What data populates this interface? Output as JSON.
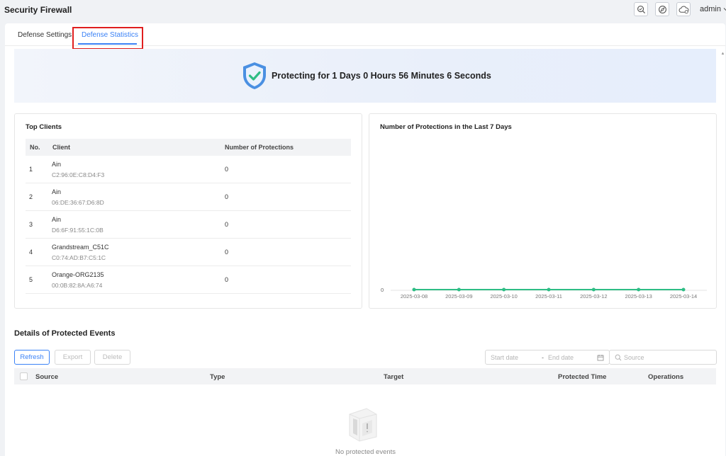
{
  "app": {
    "title": "Security Firewall",
    "user": "admin"
  },
  "topbar": {
    "icons": [
      "search-settings-icon",
      "compass-icon",
      "cloud-icon"
    ]
  },
  "tabs": [
    {
      "label": "Defense Settings",
      "active": false
    },
    {
      "label": "Defense Statistics",
      "active": true
    }
  ],
  "banner": {
    "text": "Protecting for 1 Days 0 Hours 56 Minutes 6 Seconds"
  },
  "top_clients": {
    "title": "Top Clients",
    "columns": [
      "No.",
      "Client",
      "Number of Protections"
    ],
    "rows": [
      {
        "no": "1",
        "name": "Ain",
        "mac": "C2:96:0E:C8:D4:F3",
        "count": "0"
      },
      {
        "no": "2",
        "name": "Ain",
        "mac": "06:DE:36:67:D6:8D",
        "count": "0"
      },
      {
        "no": "3",
        "name": "Ain",
        "mac": "D6:6F:91:55:1C:0B",
        "count": "0"
      },
      {
        "no": "4",
        "name": "Grandstream_C51C",
        "mac": "C0:74:AD:B7:C5:1C",
        "count": "0"
      },
      {
        "no": "5",
        "name": "Orange-ORG2135",
        "mac": "00:0B:82:8A:A6:74",
        "count": "0"
      }
    ]
  },
  "chart_data": {
    "type": "line",
    "title": "Number of Protections in the Last 7 Days",
    "x": [
      "2025-03-08",
      "2025-03-09",
      "2025-03-10",
      "2025-03-11",
      "2025-03-12",
      "2025-03-13",
      "2025-03-14"
    ],
    "values": [
      0,
      0,
      0,
      0,
      0,
      0,
      0
    ],
    "y_ticks": [
      "0"
    ],
    "color": "#2ebd85",
    "grid": false
  },
  "events": {
    "title": "Details of Protected Events",
    "buttons": {
      "refresh": "Refresh",
      "export": "Export",
      "delete": "Delete"
    },
    "start_date_placeholder": "Start date",
    "date_separator": "-",
    "end_date_placeholder": "End date",
    "search_placeholder": "Source",
    "columns": {
      "source": "Source",
      "type": "Type",
      "target": "Target",
      "time": "Protected Time",
      "ops": "Operations"
    },
    "empty_text": "No protected events"
  },
  "colors": {
    "accent": "#3b82f6",
    "highlight": "#e01f1f",
    "success": "#2ebd85"
  }
}
